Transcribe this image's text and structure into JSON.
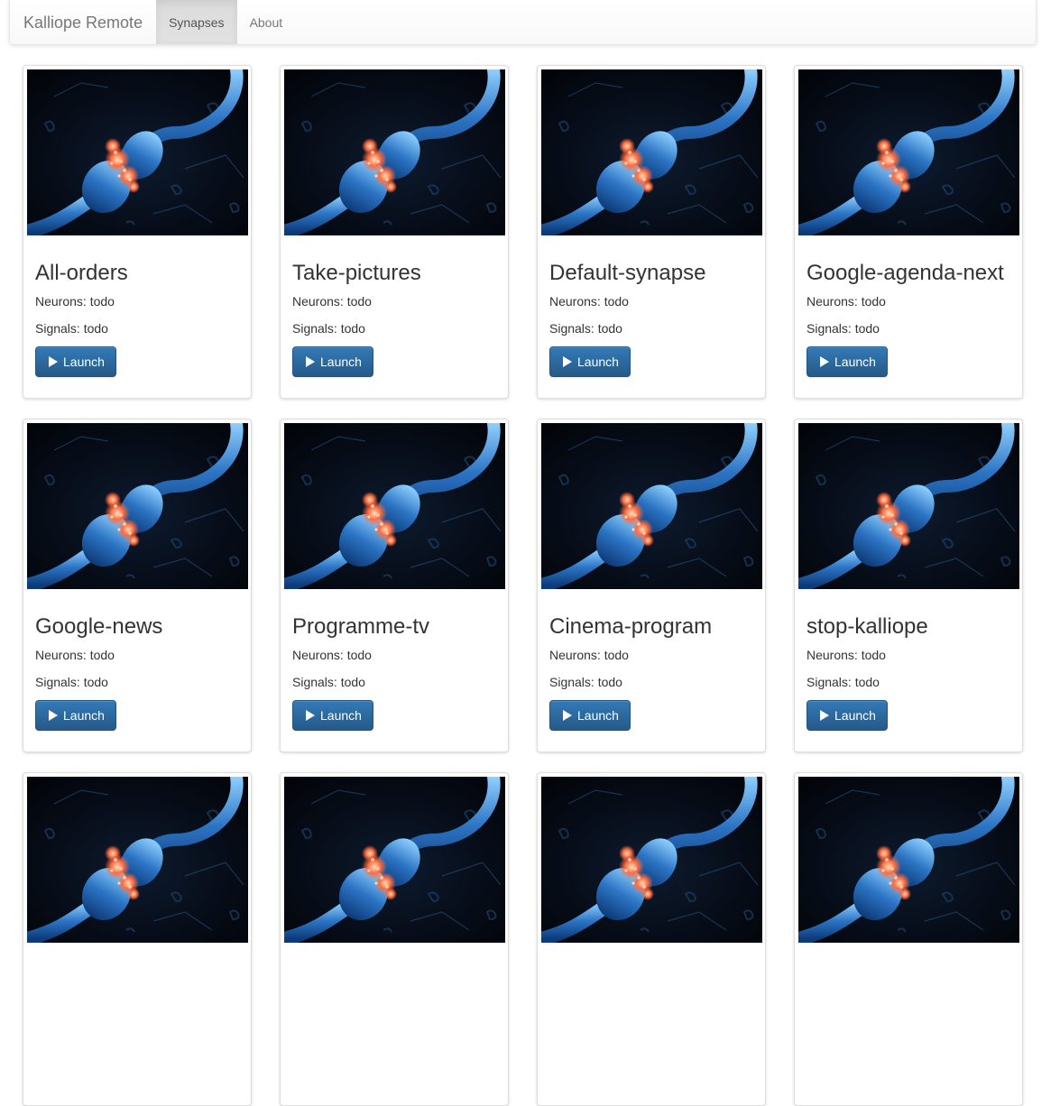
{
  "navbar": {
    "brand": "Kalliope Remote",
    "links": [
      {
        "label": "Synapses",
        "active": true
      },
      {
        "label": "About",
        "active": false
      }
    ]
  },
  "synapse_card": {
    "neurons_label": "Neurons:",
    "signals_label": "Signals:",
    "launch_label": "Launch",
    "launch_icon": "play-icon",
    "image": "neuron-synapse-image"
  },
  "synapses": [
    {
      "name": "All-orders",
      "neurons": "todo",
      "signals": "todo"
    },
    {
      "name": "Take-pictures",
      "neurons": "todo",
      "signals": "todo"
    },
    {
      "name": "Default-synapse",
      "neurons": "todo",
      "signals": "todo"
    },
    {
      "name": "Google-agenda-next",
      "neurons": "todo",
      "signals": "todo"
    },
    {
      "name": "Google-news",
      "neurons": "todo",
      "signals": "todo"
    },
    {
      "name": "Programme-tv",
      "neurons": "todo",
      "signals": "todo"
    },
    {
      "name": "Cinema-program",
      "neurons": "todo",
      "signals": "todo"
    },
    {
      "name": "stop-kalliope",
      "neurons": "todo",
      "signals": "todo"
    }
  ],
  "colors": {
    "primary": "#337ab7",
    "primary_dark": "#265a88",
    "synapse_glow": "#5fb6ff",
    "synapse_spark": "#ff6a3d"
  }
}
